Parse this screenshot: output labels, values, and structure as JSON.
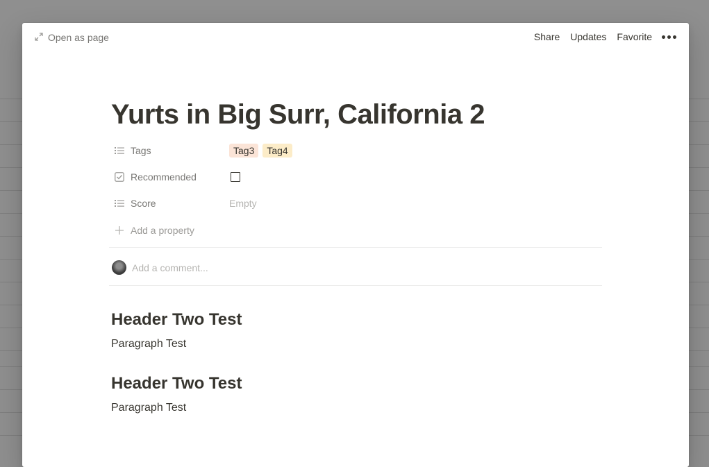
{
  "topbar": {
    "open_as_page": "Open as page",
    "actions": [
      "Share",
      "Updates",
      "Favorite"
    ]
  },
  "page": {
    "title": "Yurts in Big Surr, California 2"
  },
  "properties": {
    "tags": {
      "label": "Tags",
      "values": [
        "Tag3",
        "Tag4"
      ]
    },
    "recommended": {
      "label": "Recommended",
      "checked": false
    },
    "score": {
      "label": "Score",
      "value": "Empty"
    },
    "add_property": "Add a property"
  },
  "comment": {
    "placeholder": "Add a comment..."
  },
  "content": {
    "blocks": [
      {
        "heading": "Header Two Test",
        "paragraph": "Paragraph Test"
      },
      {
        "heading": "Header Two Test",
        "paragraph": "Paragraph Test"
      }
    ]
  },
  "colors": {
    "tag3_bg": "#fbe4d7",
    "tag4_bg": "#fcecc8",
    "text": "#37352f",
    "muted": "#787774",
    "backdrop": "#8f8f8f"
  },
  "icons": {
    "open_as_page": "expand-arrow-icon",
    "tags": "list-icon",
    "recommended": "checkbox-property-icon",
    "score": "list-icon",
    "add_property": "plus-icon",
    "more": "more-dots-icon"
  }
}
